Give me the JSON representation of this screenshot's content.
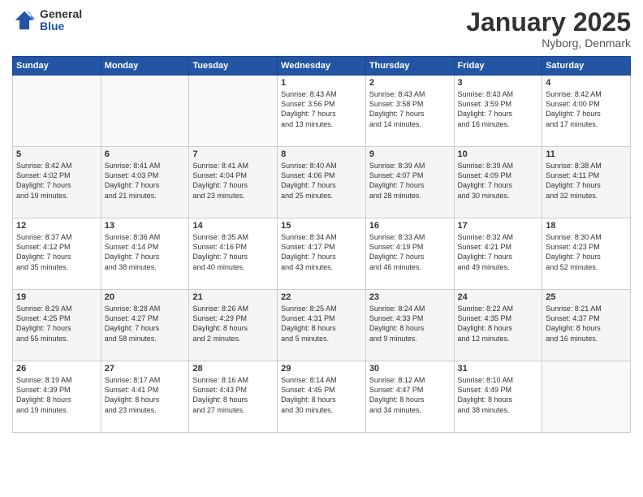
{
  "header": {
    "logo_general": "General",
    "logo_blue": "Blue",
    "month_title": "January 2025",
    "location": "Nyborg, Denmark"
  },
  "weekdays": [
    "Sunday",
    "Monday",
    "Tuesday",
    "Wednesday",
    "Thursday",
    "Friday",
    "Saturday"
  ],
  "weeks": [
    [
      {
        "day": "",
        "info": ""
      },
      {
        "day": "",
        "info": ""
      },
      {
        "day": "",
        "info": ""
      },
      {
        "day": "1",
        "info": "Sunrise: 8:43 AM\nSunset: 3:56 PM\nDaylight: 7 hours\nand 13 minutes."
      },
      {
        "day": "2",
        "info": "Sunrise: 8:43 AM\nSunset: 3:58 PM\nDaylight: 7 hours\nand 14 minutes."
      },
      {
        "day": "3",
        "info": "Sunrise: 8:43 AM\nSunset: 3:59 PM\nDaylight: 7 hours\nand 16 minutes."
      },
      {
        "day": "4",
        "info": "Sunrise: 8:42 AM\nSunset: 4:00 PM\nDaylight: 7 hours\nand 17 minutes."
      }
    ],
    [
      {
        "day": "5",
        "info": "Sunrise: 8:42 AM\nSunset: 4:02 PM\nDaylight: 7 hours\nand 19 minutes."
      },
      {
        "day": "6",
        "info": "Sunrise: 8:41 AM\nSunset: 4:03 PM\nDaylight: 7 hours\nand 21 minutes."
      },
      {
        "day": "7",
        "info": "Sunrise: 8:41 AM\nSunset: 4:04 PM\nDaylight: 7 hours\nand 23 minutes."
      },
      {
        "day": "8",
        "info": "Sunrise: 8:40 AM\nSunset: 4:06 PM\nDaylight: 7 hours\nand 25 minutes."
      },
      {
        "day": "9",
        "info": "Sunrise: 8:39 AM\nSunset: 4:07 PM\nDaylight: 7 hours\nand 28 minutes."
      },
      {
        "day": "10",
        "info": "Sunrise: 8:39 AM\nSunset: 4:09 PM\nDaylight: 7 hours\nand 30 minutes."
      },
      {
        "day": "11",
        "info": "Sunrise: 8:38 AM\nSunset: 4:11 PM\nDaylight: 7 hours\nand 32 minutes."
      }
    ],
    [
      {
        "day": "12",
        "info": "Sunrise: 8:37 AM\nSunset: 4:12 PM\nDaylight: 7 hours\nand 35 minutes."
      },
      {
        "day": "13",
        "info": "Sunrise: 8:36 AM\nSunset: 4:14 PM\nDaylight: 7 hours\nand 38 minutes."
      },
      {
        "day": "14",
        "info": "Sunrise: 8:35 AM\nSunset: 4:16 PM\nDaylight: 7 hours\nand 40 minutes."
      },
      {
        "day": "15",
        "info": "Sunrise: 8:34 AM\nSunset: 4:17 PM\nDaylight: 7 hours\nand 43 minutes."
      },
      {
        "day": "16",
        "info": "Sunrise: 8:33 AM\nSunset: 4:19 PM\nDaylight: 7 hours\nand 46 minutes."
      },
      {
        "day": "17",
        "info": "Sunrise: 8:32 AM\nSunset: 4:21 PM\nDaylight: 7 hours\nand 49 minutes."
      },
      {
        "day": "18",
        "info": "Sunrise: 8:30 AM\nSunset: 4:23 PM\nDaylight: 7 hours\nand 52 minutes."
      }
    ],
    [
      {
        "day": "19",
        "info": "Sunrise: 8:29 AM\nSunset: 4:25 PM\nDaylight: 7 hours\nand 55 minutes."
      },
      {
        "day": "20",
        "info": "Sunrise: 8:28 AM\nSunset: 4:27 PM\nDaylight: 7 hours\nand 58 minutes."
      },
      {
        "day": "21",
        "info": "Sunrise: 8:26 AM\nSunset: 4:29 PM\nDaylight: 8 hours\nand 2 minutes."
      },
      {
        "day": "22",
        "info": "Sunrise: 8:25 AM\nSunset: 4:31 PM\nDaylight: 8 hours\nand 5 minutes."
      },
      {
        "day": "23",
        "info": "Sunrise: 8:24 AM\nSunset: 4:33 PM\nDaylight: 8 hours\nand 9 minutes."
      },
      {
        "day": "24",
        "info": "Sunrise: 8:22 AM\nSunset: 4:35 PM\nDaylight: 8 hours\nand 12 minutes."
      },
      {
        "day": "25",
        "info": "Sunrise: 8:21 AM\nSunset: 4:37 PM\nDaylight: 8 hours\nand 16 minutes."
      }
    ],
    [
      {
        "day": "26",
        "info": "Sunrise: 8:19 AM\nSunset: 4:39 PM\nDaylight: 8 hours\nand 19 minutes."
      },
      {
        "day": "27",
        "info": "Sunrise: 8:17 AM\nSunset: 4:41 PM\nDaylight: 8 hours\nand 23 minutes."
      },
      {
        "day": "28",
        "info": "Sunrise: 8:16 AM\nSunset: 4:43 PM\nDaylight: 8 hours\nand 27 minutes."
      },
      {
        "day": "29",
        "info": "Sunrise: 8:14 AM\nSunset: 4:45 PM\nDaylight: 8 hours\nand 30 minutes."
      },
      {
        "day": "30",
        "info": "Sunrise: 8:12 AM\nSunset: 4:47 PM\nDaylight: 8 hours\nand 34 minutes."
      },
      {
        "day": "31",
        "info": "Sunrise: 8:10 AM\nSunset: 4:49 PM\nDaylight: 8 hours\nand 38 minutes."
      },
      {
        "day": "",
        "info": ""
      }
    ]
  ]
}
